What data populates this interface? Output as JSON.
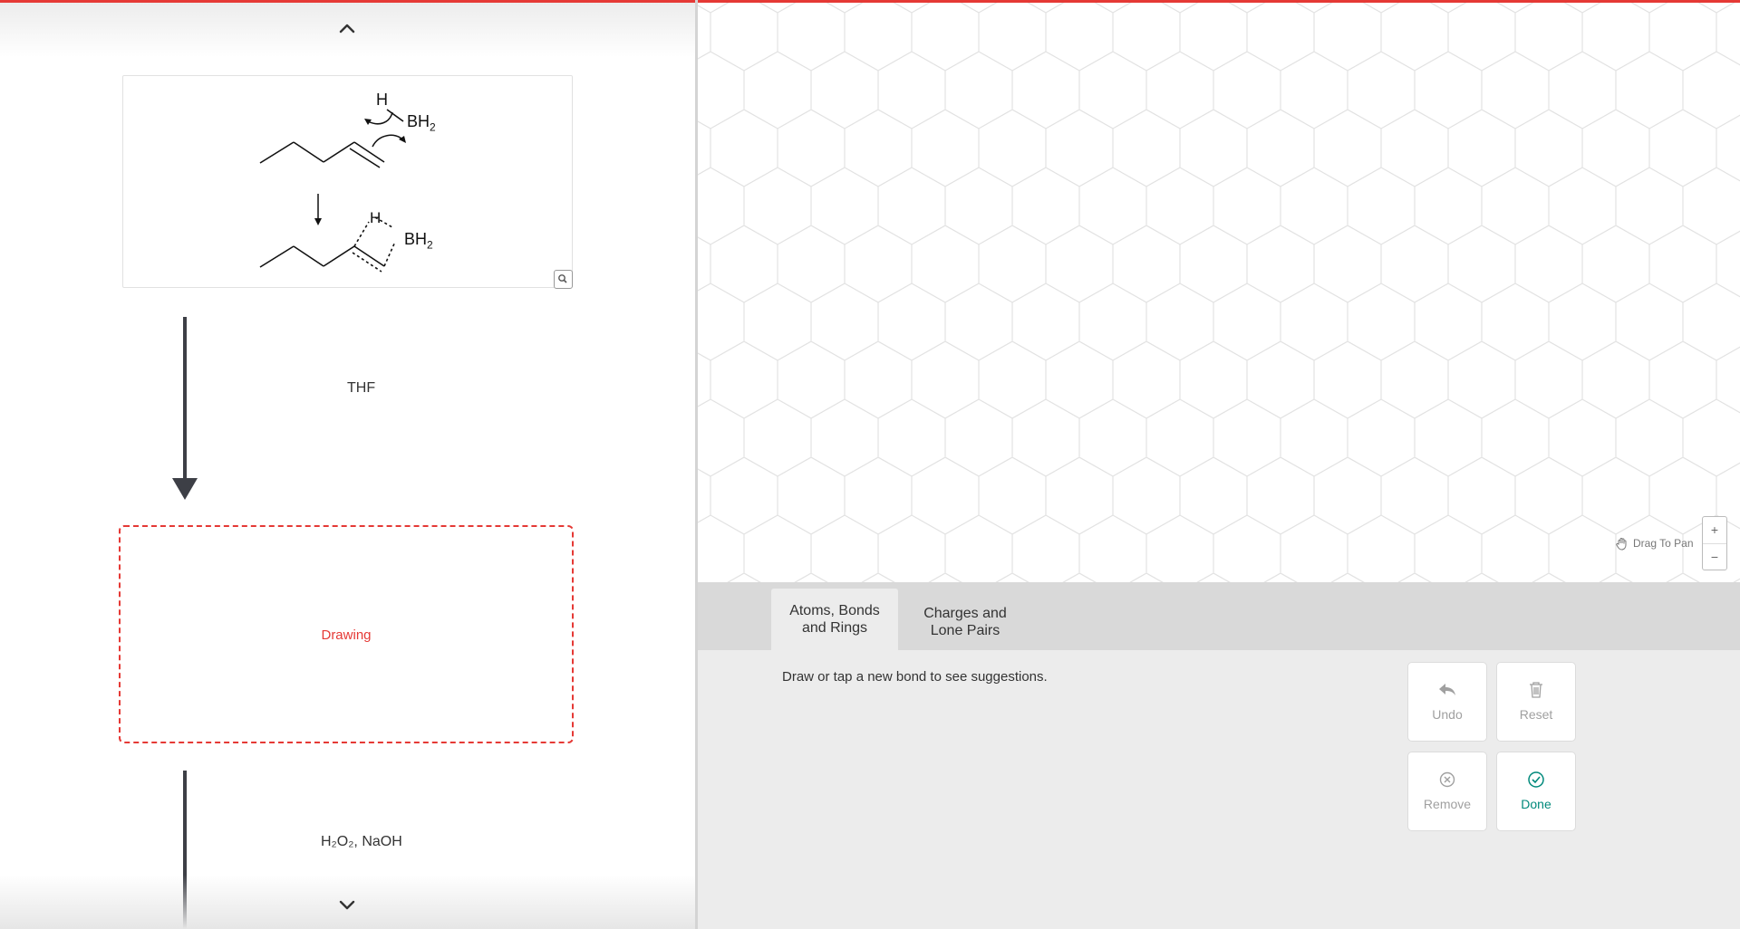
{
  "mechanism": {
    "step1": {
      "h": "H",
      "borane": "BH",
      "sub": "2"
    },
    "step2": {
      "h": "H",
      "borane": "BH",
      "sub": "2"
    }
  },
  "reagents": {
    "first": "THF",
    "second": "H₂O₂, NaOH"
  },
  "drawing_placeholder": "Drawing",
  "canvas": {
    "drag_to_pan": "Drag To Pan",
    "zoom_in": "+",
    "zoom_out": "−"
  },
  "tabs": [
    {
      "label": "Atoms, Bonds\nand Rings",
      "active": true
    },
    {
      "label": "Charges and\nLone Pairs",
      "active": false
    }
  ],
  "hint": "Draw or tap a new bond to see suggestions.",
  "actions": {
    "undo": "Undo",
    "reset": "Reset",
    "remove": "Remove",
    "done": "Done"
  },
  "colors": {
    "accent": "#e53935",
    "done": "#00897b"
  }
}
